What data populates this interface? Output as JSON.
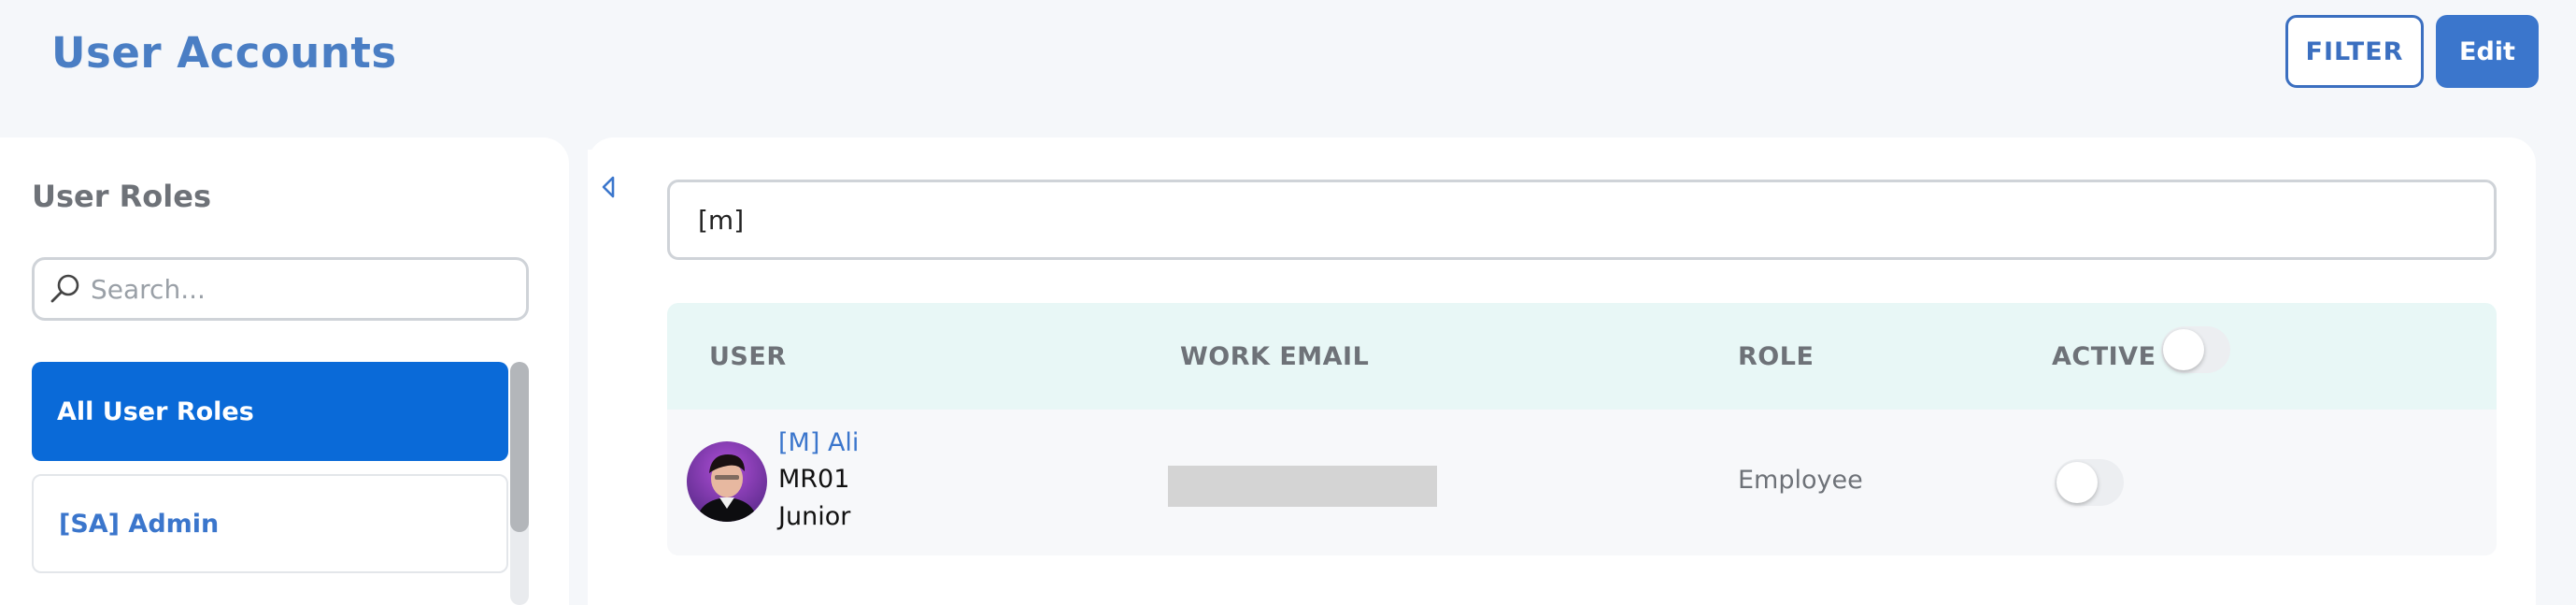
{
  "header": {
    "title": "User Accounts",
    "filter_label": "FILTER",
    "edit_label": "Edit"
  },
  "roles": {
    "title": "User Roles",
    "search_placeholder": "Search...",
    "items": [
      {
        "label": "All User Roles",
        "selected": true
      },
      {
        "label": "[SA] Admin",
        "selected": false
      }
    ]
  },
  "main": {
    "search_value": "[m]",
    "columns": [
      "USER",
      "WORK EMAIL",
      "ROLE",
      "ACTIVE"
    ],
    "header_toggle_on": false,
    "rows": [
      {
        "name": "[M] Ali",
        "code": "MR01",
        "level": "Junior",
        "email": "",
        "role": "Employee",
        "active": false
      }
    ]
  },
  "colors": {
    "accent": "#3b76cc",
    "selected_role_bg": "#0a6ad8",
    "table_header_bg": "#e8f7f6"
  },
  "icons": [
    "search-icon",
    "collapse-chevron-icon"
  ]
}
